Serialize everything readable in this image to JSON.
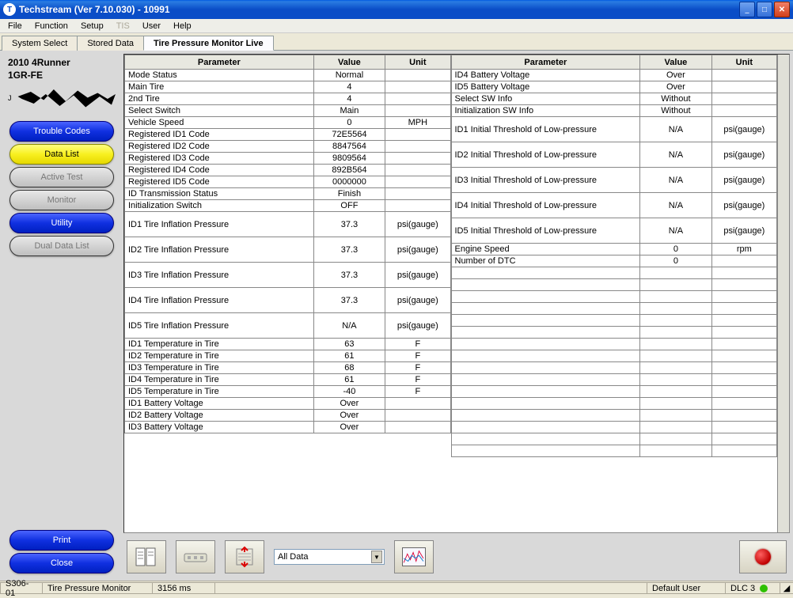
{
  "window": {
    "title": "Techstream (Ver 7.10.030) - 10991"
  },
  "menu": {
    "items": [
      "File",
      "Function",
      "Setup",
      "TIS",
      "User",
      "Help"
    ],
    "disabled_index": 3
  },
  "tabs": {
    "items": [
      "System Select",
      "Stored Data",
      "Tire Pressure Monitor Live"
    ],
    "active_index": 2
  },
  "sidebar": {
    "vehicle_line1": "2010 4Runner",
    "vehicle_line2": "1GR-FE",
    "vin_label": "J",
    "buttons": [
      {
        "label": "Trouble Codes",
        "style": "blue"
      },
      {
        "label": "Data List",
        "style": "yellow"
      },
      {
        "label": "Active Test",
        "style": "disabled"
      },
      {
        "label": "Monitor",
        "style": "disabled"
      },
      {
        "label": "Utility",
        "style": "blue"
      },
      {
        "label": "Dual Data List",
        "style": "disabled"
      }
    ],
    "footer_buttons": [
      {
        "label": "Print",
        "style": "blue"
      },
      {
        "label": "Close",
        "style": "blue"
      }
    ]
  },
  "grid_headers": {
    "param": "Parameter",
    "value": "Value",
    "unit": "Unit"
  },
  "left_rows": [
    {
      "p": "Mode Status",
      "v": "Normal",
      "u": ""
    },
    {
      "p": "Main Tire",
      "v": "4",
      "u": ""
    },
    {
      "p": "2nd Tire",
      "v": "4",
      "u": ""
    },
    {
      "p": "Select Switch",
      "v": "Main",
      "u": ""
    },
    {
      "p": "Vehicle Speed",
      "v": "0",
      "u": "MPH"
    },
    {
      "p": "Registered ID1 Code",
      "v": "72E5564",
      "u": ""
    },
    {
      "p": "Registered ID2 Code",
      "v": "8847564",
      "u": ""
    },
    {
      "p": "Registered ID3 Code",
      "v": "9809564",
      "u": ""
    },
    {
      "p": "Registered ID4 Code",
      "v": "892B564",
      "u": ""
    },
    {
      "p": "Registered ID5 Code",
      "v": "0000000",
      "u": ""
    },
    {
      "p": "ID Transmission Status",
      "v": "Finish",
      "u": ""
    },
    {
      "p": "Initialization Switch",
      "v": "OFF",
      "u": ""
    },
    {
      "p": "ID1 Tire Inflation Pressure",
      "v": "37.3",
      "u": "psi(gauge)",
      "tall": true
    },
    {
      "p": "ID2 Tire Inflation Pressure",
      "v": "37.3",
      "u": "psi(gauge)",
      "tall": true
    },
    {
      "p": "ID3 Tire Inflation Pressure",
      "v": "37.3",
      "u": "psi(gauge)",
      "tall": true
    },
    {
      "p": "ID4 Tire Inflation Pressure",
      "v": "37.3",
      "u": "psi(gauge)",
      "tall": true
    },
    {
      "p": "ID5 Tire Inflation Pressure",
      "v": "N/A",
      "u": "psi(gauge)",
      "tall": true
    },
    {
      "p": "ID1 Temperature in Tire",
      "v": "63",
      "u": "F"
    },
    {
      "p": "ID2 Temperature in Tire",
      "v": "61",
      "u": "F"
    },
    {
      "p": "ID3 Temperature in Tire",
      "v": "68",
      "u": "F"
    },
    {
      "p": "ID4 Temperature in Tire",
      "v": "61",
      "u": "F"
    },
    {
      "p": "ID5 Temperature in Tire",
      "v": "-40",
      "u": "F"
    },
    {
      "p": "ID1 Battery Voltage",
      "v": "Over",
      "u": ""
    },
    {
      "p": "ID2 Battery Voltage",
      "v": "Over",
      "u": ""
    },
    {
      "p": "ID3 Battery Voltage",
      "v": "Over",
      "u": ""
    }
  ],
  "right_rows": [
    {
      "p": "ID4 Battery Voltage",
      "v": "Over",
      "u": ""
    },
    {
      "p": "ID5 Battery Voltage",
      "v": "Over",
      "u": ""
    },
    {
      "p": "Select SW Info",
      "v": "Without",
      "u": ""
    },
    {
      "p": "Initialization SW Info",
      "v": "Without",
      "u": ""
    },
    {
      "p": "ID1 Initial Threshold of Low-pressure",
      "v": "N/A",
      "u": "psi(gauge)",
      "tall": true
    },
    {
      "p": "ID2 Initial Threshold of Low-pressure",
      "v": "N/A",
      "u": "psi(gauge)",
      "tall": true
    },
    {
      "p": "ID3 Initial Threshold of Low-pressure",
      "v": "N/A",
      "u": "psi(gauge)",
      "tall": true
    },
    {
      "p": "ID4 Initial Threshold of Low-pressure",
      "v": "N/A",
      "u": "psi(gauge)",
      "tall": true
    },
    {
      "p": "ID5 Initial Threshold of Low-pressure",
      "v": "N/A",
      "u": "psi(gauge)",
      "tall": true
    },
    {
      "p": "Engine Speed",
      "v": "0",
      "u": "rpm"
    },
    {
      "p": "Number of DTC",
      "v": "0",
      "u": ""
    }
  ],
  "right_blank_rows": 16,
  "toolbar": {
    "select_value": "All Data"
  },
  "statusbar": {
    "cell1": "S306-01",
    "cell2": "Tire Pressure Monitor",
    "cell3": "3156 ms",
    "cell_user": "Default User",
    "cell_dlc": "DLC 3"
  }
}
